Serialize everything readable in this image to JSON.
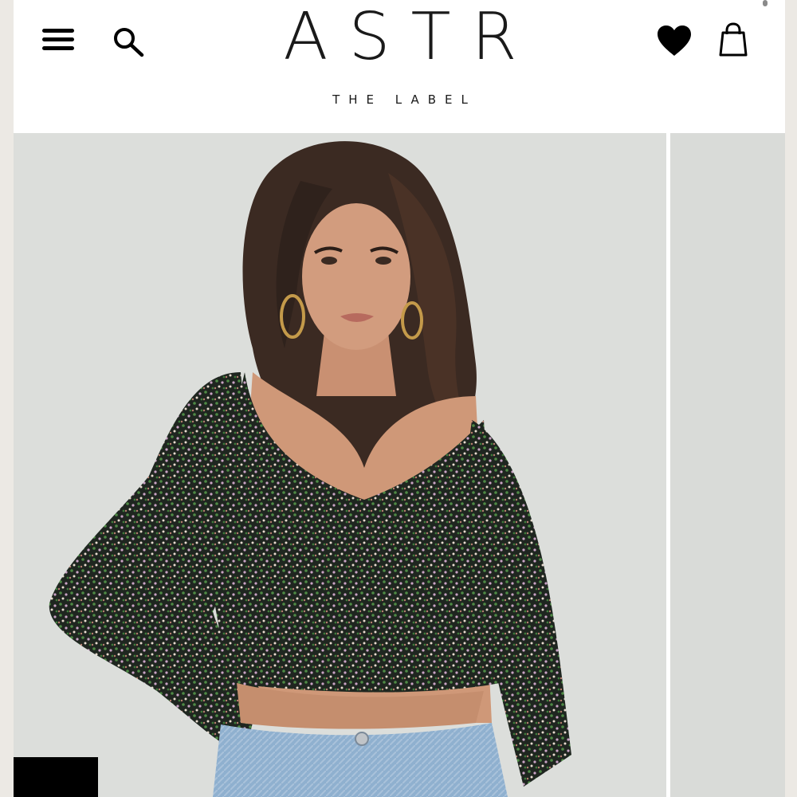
{
  "header": {
    "logo_main": "ASTR",
    "logo_sub": "THE LABEL",
    "menu_icon": "hamburger-menu-icon",
    "search_icon": "search-icon",
    "wishlist_icon": "heart-icon",
    "bag_icon": "shopping-bag-icon"
  },
  "product": {
    "images": [
      "product-photo-front",
      "product-photo-next"
    ]
  },
  "colors": {
    "background": "#ffffff",
    "text": "#1a1a1a",
    "photo_bg": "#dcdedb"
  }
}
